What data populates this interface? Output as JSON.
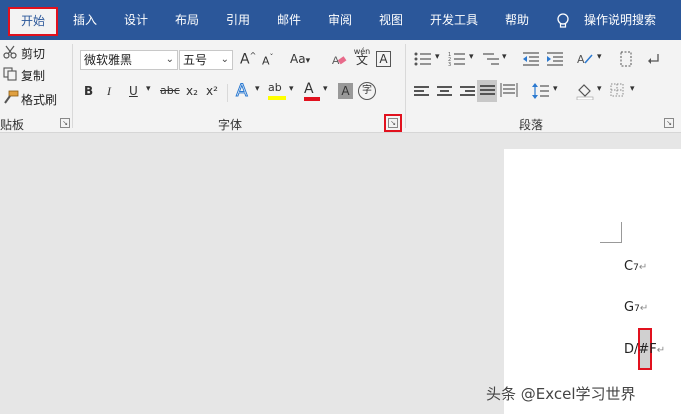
{
  "menubar": {
    "active_tab": "开始",
    "tabs": [
      "插入",
      "设计",
      "布局",
      "引用",
      "邮件",
      "审阅",
      "视图",
      "开发工具",
      "帮助"
    ],
    "search_label": "操作说明搜索"
  },
  "clipboard": {
    "cut": "剪切",
    "copy": "复制",
    "format_painter": "格式刷",
    "group_label": "粘贴板"
  },
  "font": {
    "font_name": "微软雅黑",
    "font_size": "五号",
    "grow": "A",
    "shrink": "A",
    "change_case": "Aa",
    "phonetic": "wén",
    "border_char": "A",
    "bold": "B",
    "italic": "I",
    "underline": "U",
    "strike": "abc",
    "subscript": "x₂",
    "superscript": "x²",
    "effects": "A",
    "highlight": "ab",
    "font_color": "A",
    "shading": "A",
    "enclose": "字",
    "group_label": "字体",
    "highlight_color": "#ffff00",
    "font_color_value": "#e1111e"
  },
  "paragraph": {
    "group_label": "段落"
  },
  "document": {
    "lines": [
      {
        "main": "C",
        "sub": "7"
      },
      {
        "main": "G",
        "sub": "7"
      },
      {
        "main": "D/#F",
        "sub": ""
      }
    ],
    "para_mark": "↵"
  },
  "watermark": "头条 @Excel学习世界",
  "colors": {
    "ribbon_blue": "#2b579a",
    "highlight_red": "#e1111e"
  }
}
